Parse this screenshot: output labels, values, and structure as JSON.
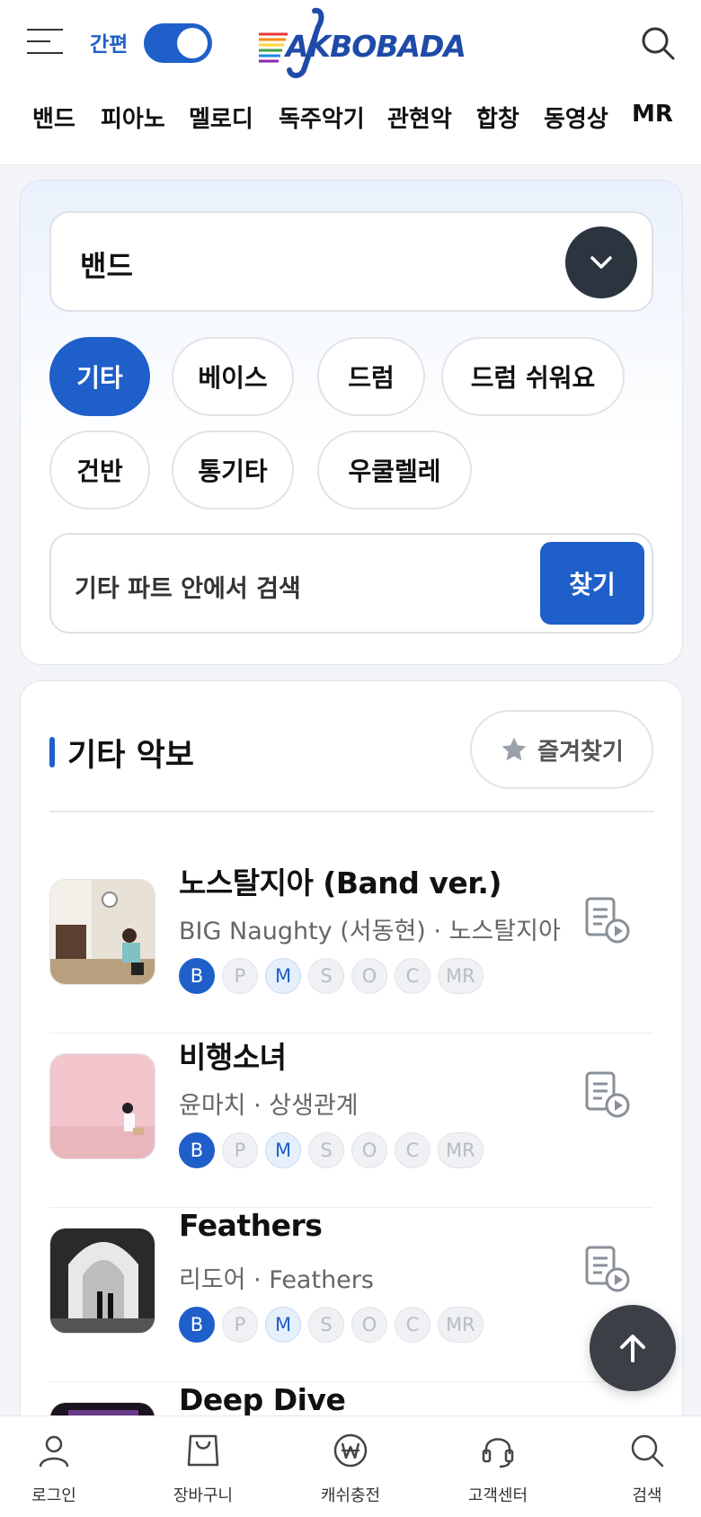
{
  "header": {
    "easy_label": "간편",
    "logo_text": "AKBOBADA",
    "nav": [
      "밴드",
      "피아노",
      "멜로디",
      "독주악기",
      "관현악",
      "합창",
      "동영상",
      "MR"
    ]
  },
  "filter": {
    "category_selected": "밴드",
    "chips": [
      "기타",
      "베이스",
      "드럼",
      "드럼 쉬워요",
      "건반",
      "통기타",
      "우쿨렐레"
    ],
    "active_chip": "기타",
    "search_placeholder": "기타 파트 안에서 검색",
    "find_label": "찾기"
  },
  "list": {
    "section_title": "기타 악보",
    "favorite_label": "즐겨찾기",
    "badge_labels": [
      "B",
      "P",
      "M",
      "S",
      "O",
      "C",
      "MR"
    ],
    "items": [
      {
        "title": "노스탈지아 (Band ver.)",
        "meta": "BIG Naughty (서동현) · 노스탈지아"
      },
      {
        "title": "비행소녀",
        "meta": "윤마치 · 상생관계"
      },
      {
        "title": "Feathers",
        "meta": "리도어 · Feathers"
      },
      {
        "title": "Deep Dive",
        "meta": ""
      }
    ]
  },
  "tabbar": {
    "tabs": [
      {
        "label": "로그인",
        "icon": "user-icon"
      },
      {
        "label": "장바구니",
        "icon": "bag-icon"
      },
      {
        "label": "캐쉬충전",
        "icon": "won-icon"
      },
      {
        "label": "고객센터",
        "icon": "headset-icon"
      },
      {
        "label": "검색",
        "icon": "search-icon"
      }
    ]
  },
  "colors": {
    "accent": "#1f5fc9",
    "dark": "#2c3440"
  }
}
